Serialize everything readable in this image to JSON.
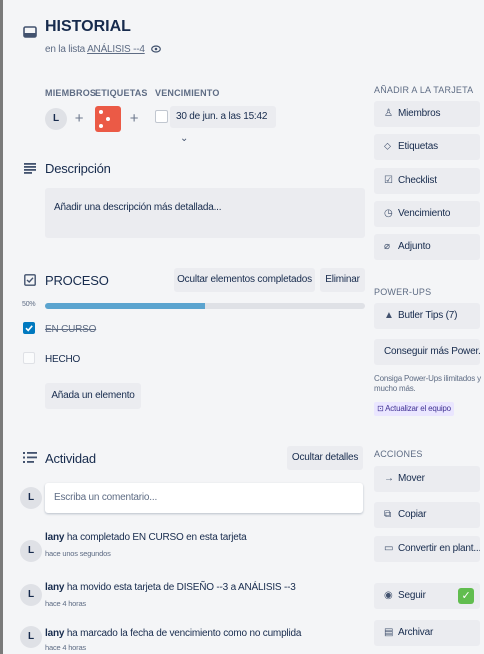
{
  "card": {
    "title": "HISTORIAL",
    "list_prefix": "en la lista",
    "list_name": "ANÁLISIS --4"
  },
  "meta": {
    "members_label": "MIEMBROS",
    "labels_label": "ETIQUETAS",
    "due_label": "VENCIMIENTO",
    "member_initial": "L",
    "plus": "+",
    "due_date": "30 de jun. a las 15:42"
  },
  "description": {
    "title": "Descripción",
    "placeholder": "Añadir una descripción más detallada..."
  },
  "checklist": {
    "title": "PROCESO",
    "hide_completed": "Ocultar elementos completados",
    "delete": "Eliminar",
    "percent": "50%",
    "progress": 0.5,
    "items": [
      {
        "text": "EN CURSO",
        "checked": true
      },
      {
        "text": "HECHO",
        "checked": false
      }
    ],
    "add_item": "Añada un elemento"
  },
  "activity": {
    "title": "Actividad",
    "hide_details": "Ocultar detalles",
    "comment_placeholder": "Escriba un comentario...",
    "entries": [
      {
        "user": "lany",
        "text": "ha completado EN CURSO en esta tarjeta",
        "time": "hace unos segundos"
      },
      {
        "user": "lany",
        "text": "ha movido esta tarjeta de DISEÑO --3 a ANÁLISIS --3",
        "time": "hace 4 horas"
      },
      {
        "user": "lany",
        "text": "ha marcado la fecha de vencimiento como no cumplida",
        "time": "hace 4 horas"
      }
    ]
  },
  "sidebar": {
    "add_heading": "AÑADIR A LA TARJETA",
    "add_items": [
      "Miembros",
      "Etiquetas",
      "Checklist",
      "Vencimiento",
      "Adjunto"
    ],
    "powerups_heading": "POWER-UPS",
    "butler": "Butler Tips (7)",
    "more_powerups": "Conseguir más Power...",
    "powerups_note": "Consiga Power-Ups ilimitados y mucho más.",
    "upgrade": "Actualizar el equipo",
    "actions_heading": "ACCIONES",
    "actions": [
      "Mover",
      "Copiar",
      "Convertir en plant...",
      "Seguir",
      "Archivar"
    ]
  },
  "colors": {
    "label_red": "#eb5a46",
    "progress_blue": "#5ba4cf",
    "check_blue": "#0079bf",
    "follow_green": "#61bd4f"
  }
}
